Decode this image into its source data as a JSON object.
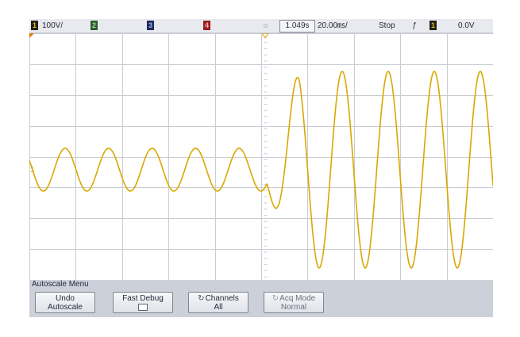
{
  "status": {
    "ch1": {
      "number": "1",
      "scale": "100V/"
    },
    "ch2": {
      "number": "2"
    },
    "ch3": {
      "number": "3"
    },
    "ch4": {
      "number": "4"
    },
    "delay": "1.049s",
    "timebase": "20.00㎳/",
    "run_state": "Stop",
    "trigger_slope_icon": "ƒ",
    "trigger_source": "1",
    "trigger_level": "0.0V"
  },
  "screen": {
    "ground_marker": "1",
    "delay_icon": "sun-delay-icon"
  },
  "menu": {
    "title": "Autoscale Menu",
    "softkeys": [
      {
        "line1": "Undo",
        "line2": "Autoscale"
      },
      {
        "line1": "Fast Debug"
      },
      {
        "line1": "Channels",
        "line2": "All",
        "icon": "entry-knob-icon"
      },
      {
        "line1": "Acq Mode",
        "line2": "Normal",
        "icon": "entry-knob-icon"
      }
    ]
  },
  "colors": {
    "trace": "#d9a800",
    "grid": "#c9ccd3"
  }
}
